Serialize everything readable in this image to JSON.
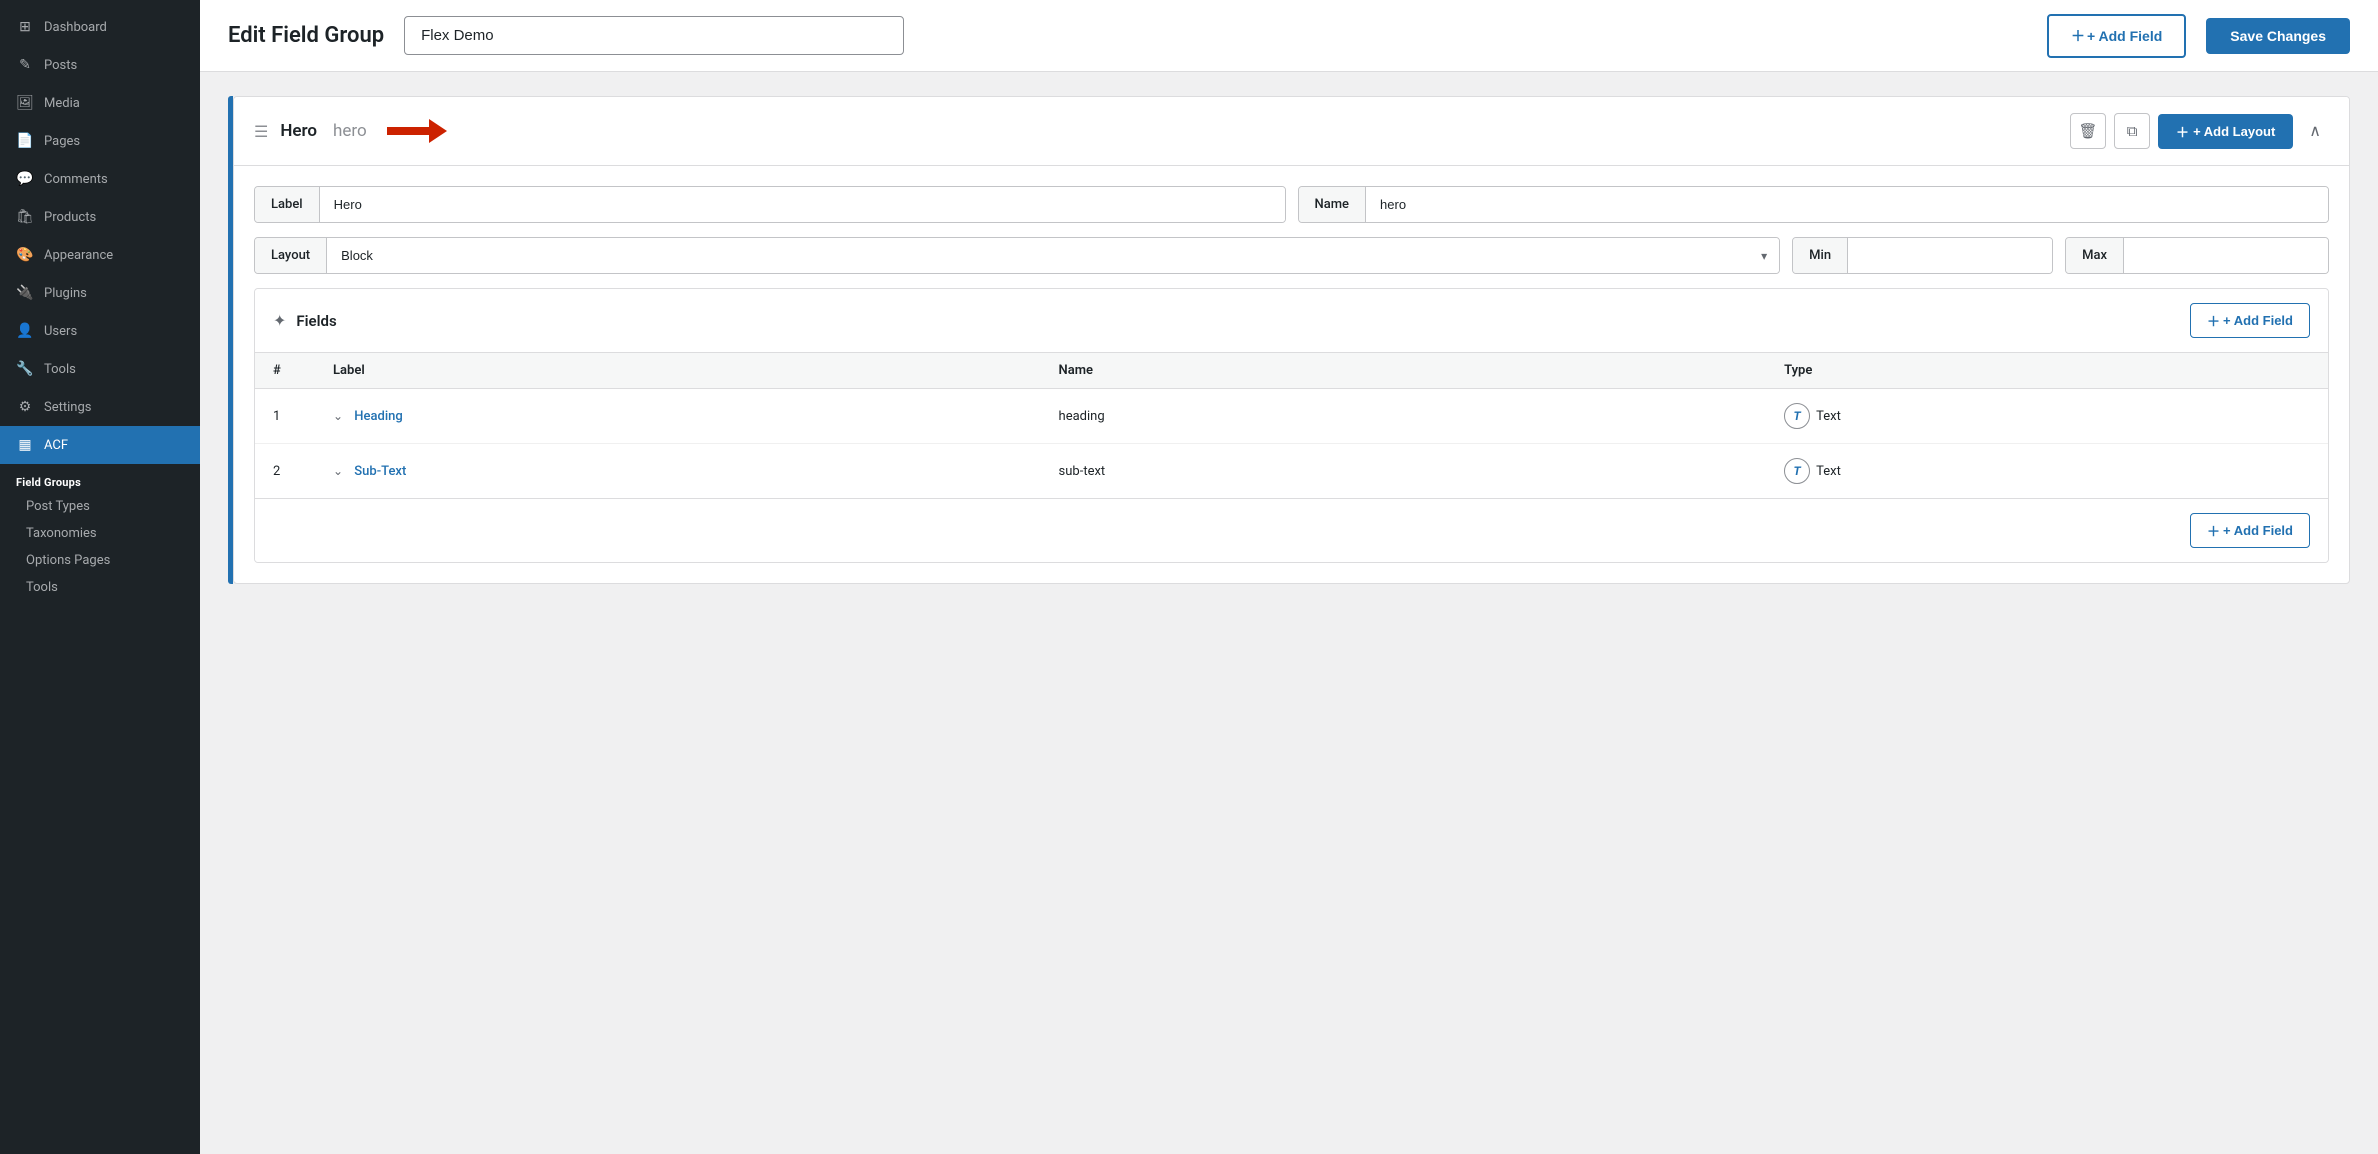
{
  "sidebar": {
    "items": [
      {
        "id": "dashboard",
        "label": "Dashboard",
        "icon": "⊞"
      },
      {
        "id": "posts",
        "label": "Posts",
        "icon": "✎"
      },
      {
        "id": "media",
        "label": "Media",
        "icon": "🖼"
      },
      {
        "id": "pages",
        "label": "Pages",
        "icon": "📄"
      },
      {
        "id": "comments",
        "label": "Comments",
        "icon": "💬"
      },
      {
        "id": "products",
        "label": "Products",
        "icon": "🛍"
      },
      {
        "id": "appearance",
        "label": "Appearance",
        "icon": "🎨"
      },
      {
        "id": "plugins",
        "label": "Plugins",
        "icon": "🔌"
      },
      {
        "id": "users",
        "label": "Users",
        "icon": "👤"
      },
      {
        "id": "tools",
        "label": "Tools",
        "icon": "🔧"
      },
      {
        "id": "settings",
        "label": "Settings",
        "icon": "⚙"
      }
    ],
    "acf": {
      "label": "ACF",
      "icon": "▦"
    },
    "sub_items": [
      {
        "id": "field-groups",
        "label": "Field Groups",
        "active": true
      },
      {
        "id": "post-types",
        "label": "Post Types"
      },
      {
        "id": "taxonomies",
        "label": "Taxonomies"
      },
      {
        "id": "options-pages",
        "label": "Options Pages"
      },
      {
        "id": "tools-sub",
        "label": "Tools"
      }
    ]
  },
  "header": {
    "title": "Edit Field Group",
    "field_group_name": "Flex Demo",
    "add_field_label": "+ Add Field",
    "save_changes_label": "Save Changes"
  },
  "layout_card": {
    "title": "Hero",
    "subtitle": "hero",
    "add_layout_label": "+ Add Layout",
    "fields_label": "Label",
    "fields_name_label": "Name",
    "label_value": "Hero",
    "name_value": "hero",
    "layout_label": "Layout",
    "layout_value": "Block",
    "min_label": "Min",
    "min_value": "",
    "max_label": "Max",
    "max_value": ""
  },
  "fields_section": {
    "title": "Fields",
    "add_field_label": "+ Add Field",
    "columns": [
      "#",
      "Label",
      "Name",
      "Type"
    ],
    "rows": [
      {
        "num": "1",
        "label": "Heading",
        "name": "heading",
        "type": "Text",
        "type_icon": "T"
      },
      {
        "num": "2",
        "label": "Sub-Text",
        "name": "sub-text",
        "type": "Text",
        "type_icon": "T"
      }
    ],
    "add_field_bottom_label": "+ Add Field"
  }
}
